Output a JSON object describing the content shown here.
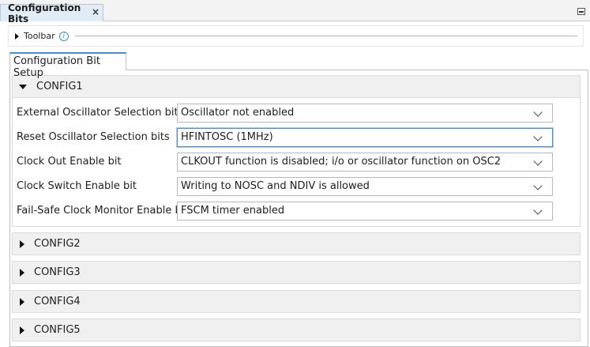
{
  "window": {
    "tab_title": "Configuration Bits",
    "close_glyph": "×"
  },
  "toolbar": {
    "label": "Toolbar",
    "info_glyph": "i"
  },
  "setup_tab": {
    "label": "Configuration Bit Setup"
  },
  "sections": [
    {
      "title": "CONFIG1",
      "expanded": true
    },
    {
      "title": "CONFIG2",
      "expanded": false
    },
    {
      "title": "CONFIG3",
      "expanded": false
    },
    {
      "title": "CONFIG4",
      "expanded": false
    },
    {
      "title": "CONFIG5",
      "expanded": false
    }
  ],
  "config1_rows": [
    {
      "label": "External Oscillator Selection bits",
      "value": "Oscillator not enabled"
    },
    {
      "label": "Reset Oscillator Selection bits",
      "value": "HFINTOSC (1MHz)"
    },
    {
      "label": "Clock Out Enable bit",
      "value": "CLKOUT function is disabled; i/o or oscillator function on OSC2"
    },
    {
      "label": "Clock Switch Enable bit",
      "value": "Writing to NOSC and NDIV is allowed"
    },
    {
      "label": "Fail-Safe Clock Monitor Enable bit",
      "value": "FSCM timer enabled"
    }
  ],
  "colors": {
    "accent": "#3d8fe0",
    "header_bg": "#f0f0f0"
  }
}
